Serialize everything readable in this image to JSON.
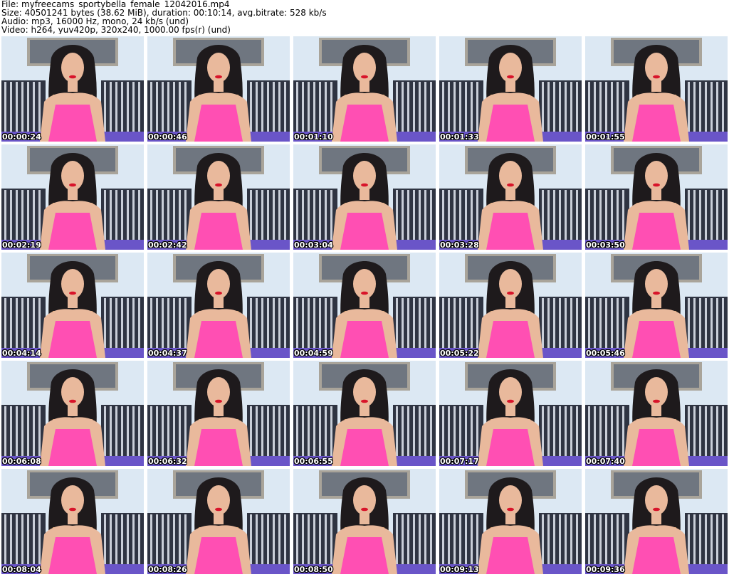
{
  "header": {
    "line1": "File: myfreecams_sportybella_female_12042016.mp4",
    "line2": "Size: 40501241 bytes (38.62 MiB), duration: 00:10:14, avg.bitrate: 528 kb/s",
    "line3": "Audio: mp3, 16000 Hz, mono, 24 kb/s (und)",
    "line4": "Video: h264, yuv420p, 320x240, 1000.00 fps(r) (und)"
  },
  "thumbnails": [
    {
      "time": "00:00:24"
    },
    {
      "time": "00:00:46"
    },
    {
      "time": "00:01:10"
    },
    {
      "time": "00:01:33"
    },
    {
      "time": "00:01:55"
    },
    {
      "time": "00:02:19"
    },
    {
      "time": "00:02:42"
    },
    {
      "time": "00:03:04"
    },
    {
      "time": "00:03:28"
    },
    {
      "time": "00:03:50"
    },
    {
      "time": "00:04:14"
    },
    {
      "time": "00:04:37"
    },
    {
      "time": "00:04:59"
    },
    {
      "time": "00:05:22"
    },
    {
      "time": "00:05:46"
    },
    {
      "time": "00:06:08"
    },
    {
      "time": "00:06:32"
    },
    {
      "time": "00:06:55"
    },
    {
      "time": "00:07:17"
    },
    {
      "time": "00:07:40"
    },
    {
      "time": "00:08:04"
    },
    {
      "time": "00:08:26"
    },
    {
      "time": "00:08:50"
    },
    {
      "time": "00:09:13"
    },
    {
      "time": "00:09:36"
    }
  ],
  "colors": {
    "wall": "#dce8f3",
    "frame": "#a9a49a",
    "picture": "#6f7680",
    "cushion_dark": "#2f3442",
    "cushion_light": "#c9ced8",
    "sofa": "#6a55c8",
    "hair": "#1e1a1c",
    "hair_tips": "#c08a4a",
    "skin": "#e9b99c",
    "dress": "#ff4fb3",
    "lips": "#d8142a"
  }
}
